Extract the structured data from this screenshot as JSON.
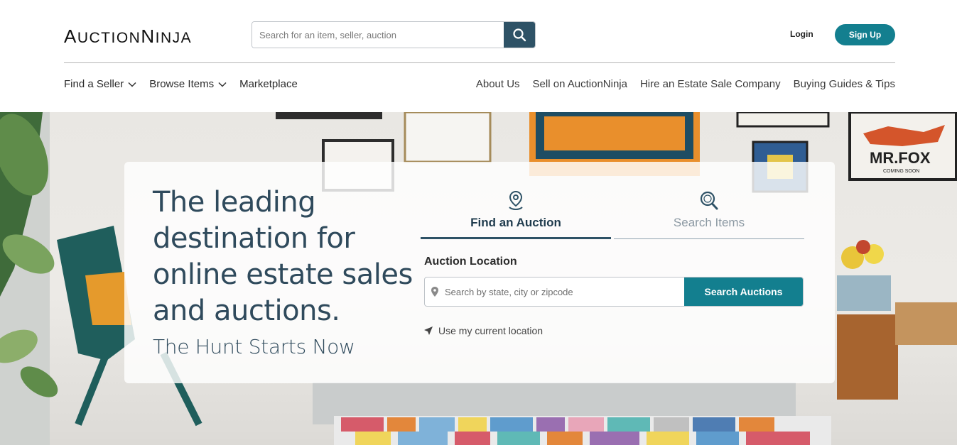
{
  "header": {
    "logo_part1_big": "A",
    "logo_part1_small": "UCTION",
    "logo_part2_big": "N",
    "logo_part2_small": "INJA",
    "search_placeholder": "Search for an item, seller, auction",
    "login_label": "Login",
    "signup_label": "Sign Up"
  },
  "nav": {
    "left": [
      "Find a Seller",
      "Browse Items",
      "Marketplace"
    ],
    "right": [
      "About Us",
      "Sell on AuctionNinja",
      "Hire an Estate Sale Company",
      "Buying Guides & Tips"
    ]
  },
  "hero": {
    "headline": "The leading destination for online estate sales and auctions.",
    "subhead": "The Hunt Starts Now",
    "poster_text": "MR.FOX",
    "poster_subtext": "COMING SOON",
    "tabs": [
      {
        "label": "Find an Auction",
        "active": true,
        "icon": "location-pin-icon"
      },
      {
        "label": "Search Items",
        "active": false,
        "icon": "search-icon"
      }
    ],
    "location_label": "Auction Location",
    "location_placeholder": "Search by state, city or zipcode",
    "search_button": "Search Auctions",
    "use_location": "Use my current location"
  },
  "colors": {
    "teal": "#137f8f",
    "navy": "#2e5266",
    "headline": "#2f4a5c"
  }
}
